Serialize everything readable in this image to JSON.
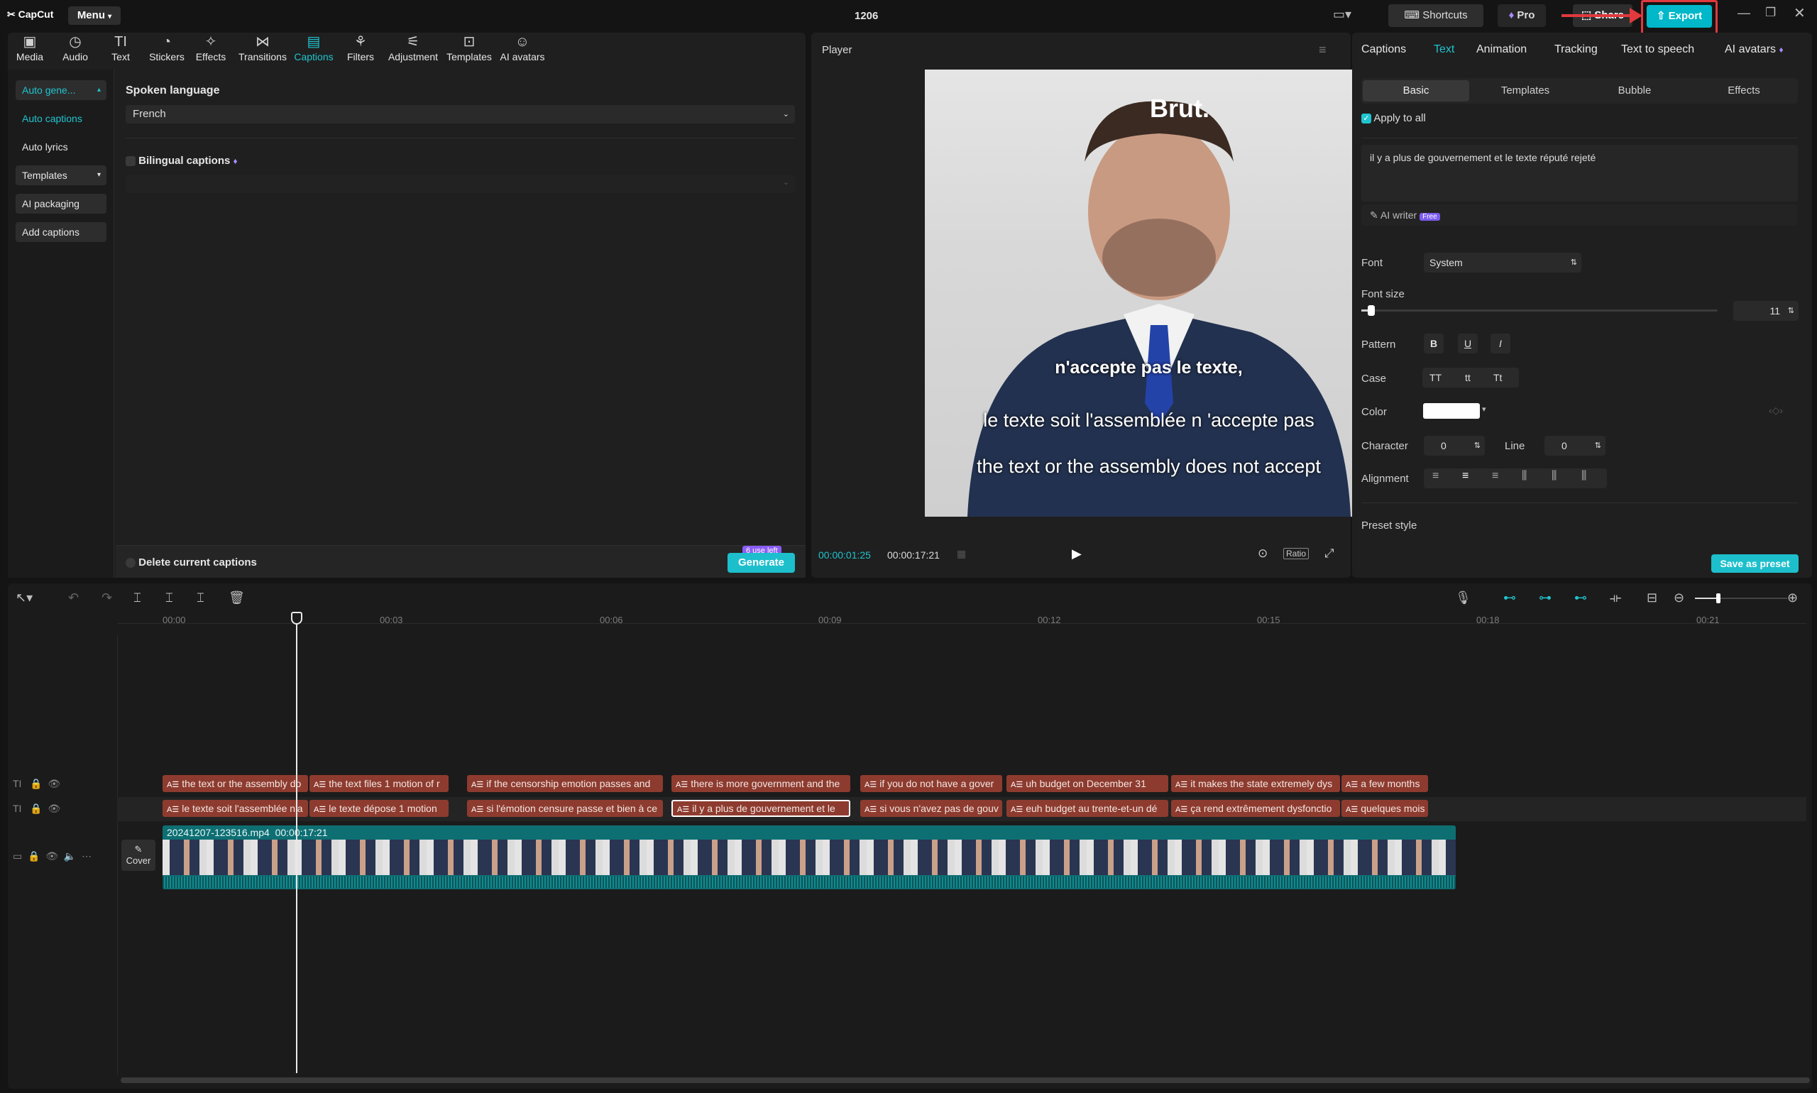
{
  "app": {
    "logo": "CapCut",
    "menu": "Menu",
    "project_title": "1206",
    "shortcuts": "Shortcuts",
    "pro": "Pro",
    "share": "Share",
    "export": "Export"
  },
  "toolbar": [
    {
      "label": "Media",
      "icon": "media-icon"
    },
    {
      "label": "Audio",
      "icon": "audio-icon"
    },
    {
      "label": "Text",
      "icon": "text-icon"
    },
    {
      "label": "Stickers",
      "icon": "stickers-icon"
    },
    {
      "label": "Effects",
      "icon": "effects-icon"
    },
    {
      "label": "Transitions",
      "icon": "transitions-icon"
    },
    {
      "label": "Captions",
      "icon": "captions-icon",
      "active": true
    },
    {
      "label": "Filters",
      "icon": "filters-icon"
    },
    {
      "label": "Adjustment",
      "icon": "adjustment-icon"
    },
    {
      "label": "Templates",
      "icon": "templates-icon"
    },
    {
      "label": "AI avatars",
      "icon": "ai-avatars-icon"
    }
  ],
  "sidebar": {
    "items": [
      "Auto gene...",
      "Auto captions",
      "Auto lyrics",
      "Templates",
      "AI packaging",
      "Add captions"
    ]
  },
  "captions_panel": {
    "spoken_language_label": "Spoken language",
    "spoken_language_value": "French",
    "bilingual_label": "Bilingual captions",
    "delete_label": "Delete current captions",
    "uses_left": "6 use left",
    "generate": "Generate"
  },
  "player": {
    "title": "Player",
    "brand": "Brut.",
    "sub1": "n'accepte pas le texte,",
    "sub2": "le texte soit l'assemblée n 'accepte pas",
    "sub3": "the text or the assembly does not accept",
    "current_time": "00:00:01:25",
    "total_time": "00:00:17:21",
    "ratio": "Ratio"
  },
  "right_panel": {
    "tabs": [
      "Captions",
      "Text",
      "Animation",
      "Tracking",
      "Text to speech",
      "AI avatars"
    ],
    "active_tab": "Text",
    "subtabs": [
      "Basic",
      "Templates",
      "Bubble",
      "Effects"
    ],
    "apply_all": "Apply to all",
    "text_value": "il y a plus de gouvernement et le texte réputé rejeté",
    "ai_writer": "AI writer",
    "free_badge": "Free",
    "font_label": "Font",
    "font_value": "System",
    "font_size_label": "Font size",
    "font_size_value": "11",
    "pattern_label": "Pattern",
    "pattern_bold": "B",
    "pattern_underline": "U",
    "pattern_italic": "I",
    "case_label": "Case",
    "case_upper": "TT",
    "case_lower": "tt",
    "case_title": "Tt",
    "color_label": "Color",
    "color_value": "#ffffff",
    "character_label": "Character",
    "character_value": "0",
    "line_label": "Line",
    "line_value": "0",
    "alignment_label": "Alignment",
    "preset_label": "Preset style",
    "save_preset": "Save as preset"
  },
  "timeline": {
    "ticks": [
      "00:00",
      "00:03",
      "00:06",
      "00:09",
      "00:12",
      "00:15",
      "00:18",
      "00:21"
    ],
    "track1": [
      "the text or the assembly do",
      "the text files 1 motion of r",
      "if the censorship emotion passes and",
      "there is more government and the",
      "if you do not have a gover",
      "uh budget on December 31",
      "it makes the state extremely dys",
      "a few months"
    ],
    "track2": [
      "le texte soit l'assemblée n'a",
      "le texte dépose 1 motion",
      "si l'émotion censure passe et bien à ce",
      "il y a plus de gouvernement et le",
      "si vous n'avez pas de gouv",
      "euh budget au trente-et-un dé",
      "ça rend extrêmement dysfonctio",
      "quelques mois"
    ],
    "video_name": "20241207-123516.mp4",
    "video_duration": "00:00:17:21",
    "cover": "Cover"
  },
  "colors": {
    "accent": "#20c4cf",
    "clip": "#8e3b2f",
    "video_track": "#0e6f73",
    "export_bg": "#00b8c9"
  }
}
